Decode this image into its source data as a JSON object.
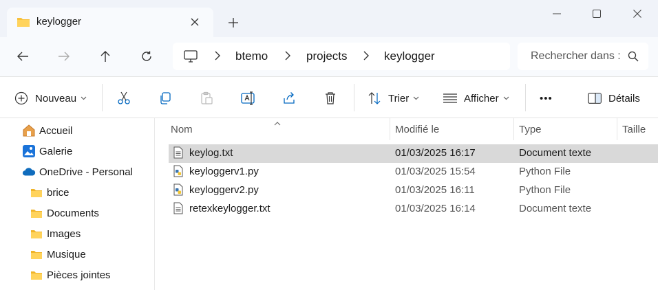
{
  "tab": {
    "title": "keylogger",
    "icon": "folder-icon"
  },
  "window": {
    "minimize": "minimize-icon",
    "maximize": "maximize-icon",
    "close": "close-icon"
  },
  "nav": {
    "back": "back-arrow-icon",
    "forward": "forward-arrow-icon",
    "up": "up-arrow-icon",
    "refresh": "refresh-icon"
  },
  "breadcrumb": [
    "btemo",
    "projects",
    "keylogger"
  ],
  "search": {
    "placeholder": "Rechercher dans : keylogger"
  },
  "toolbar": {
    "new_label": "Nouveau",
    "sort_label": "Trier",
    "view_label": "Afficher",
    "more_label": "•••",
    "details_label": "Détails"
  },
  "sidebar": {
    "items": [
      {
        "label": "Accueil",
        "icon": "home-icon"
      },
      {
        "label": "Galerie",
        "icon": "gallery-icon"
      },
      {
        "label": "OneDrive - Personal",
        "icon": "onedrive-cloud-icon"
      },
      {
        "label": "brice",
        "icon": "folder-icon"
      },
      {
        "label": "Documents",
        "icon": "folder-icon"
      },
      {
        "label": "Images",
        "icon": "folder-icon"
      },
      {
        "label": "Musique",
        "icon": "folder-icon"
      },
      {
        "label": "Pièces jointes",
        "icon": "folder-icon"
      }
    ]
  },
  "columns": {
    "name": "Nom",
    "modified": "Modifié le",
    "type": "Type",
    "size": "Taille"
  },
  "files": [
    {
      "name": "keylog.txt",
      "modified": "01/03/2025 16:17",
      "type": "Document texte",
      "icon": "text-file-icon",
      "selected": true
    },
    {
      "name": "keyloggerv1.py",
      "modified": "01/03/2025 15:54",
      "type": "Python File",
      "icon": "python-file-icon",
      "selected": false
    },
    {
      "name": "keyloggerv2.py",
      "modified": "01/03/2025 16:11",
      "type": "Python File",
      "icon": "python-file-icon",
      "selected": false
    },
    {
      "name": "retexkeylogger.txt",
      "modified": "01/03/2025 16:14",
      "type": "Document texte",
      "icon": "text-file-icon",
      "selected": false
    }
  ],
  "colors": {
    "accent": "#0067c0",
    "folder": "#f8c13c",
    "selected_row": "#d9d9d9",
    "titlebar": "#f0f3f9"
  }
}
